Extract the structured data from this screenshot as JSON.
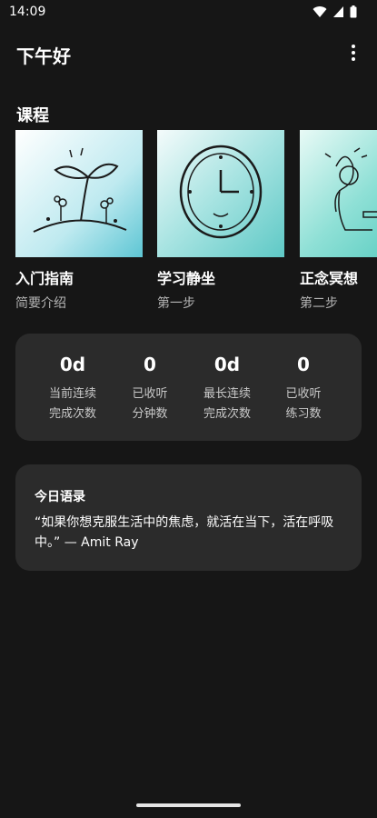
{
  "status_bar": {
    "time": "14:09",
    "icons": [
      "wifi-icon",
      "signal-icon",
      "battery-icon"
    ]
  },
  "header": {
    "greeting": "下午好",
    "menu_icon": "more-vert-icon"
  },
  "courses": {
    "section_title": "课程",
    "items": [
      {
        "title": "入门指南",
        "subtitle": "简要介绍",
        "image": "sprout-illustration"
      },
      {
        "title": "学习静坐",
        "subtitle": "第一步",
        "image": "clock-illustration"
      },
      {
        "title": "正念冥想",
        "subtitle": "第二步",
        "image": "meditation-illustration"
      }
    ]
  },
  "stats": [
    {
      "value": "0d",
      "label_line1": "当前连续",
      "label_line2": "完成次数"
    },
    {
      "value": "0",
      "label_line1": "已收听",
      "label_line2": "分钟数"
    },
    {
      "value": "0d",
      "label_line1": "最长连续",
      "label_line2": "完成次数"
    },
    {
      "value": "0",
      "label_line1": "已收听",
      "label_line2": "练习数"
    }
  ],
  "quote": {
    "title": "今日语录",
    "text": "“如果你想克服生活中的焦虑，就活在当下，活在呼吸中。” — Amit Ray"
  },
  "colors": {
    "background": "#161616",
    "card": "#2b2b2b",
    "accent_teal": "#6cd4d0",
    "secondary_text": "#b4b4b4"
  }
}
